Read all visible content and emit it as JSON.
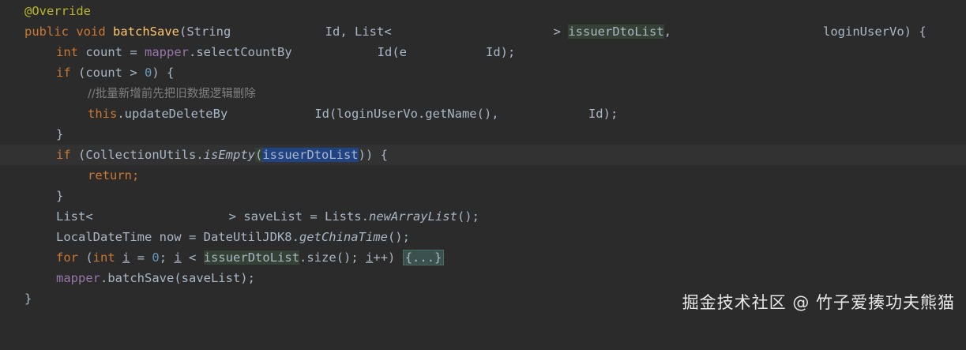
{
  "code": {
    "l1_annotation": "@Override",
    "l2_kw1": "public",
    "l2_kw2": "void",
    "l2_method": "batchSave",
    "l2_p1": "(String ",
    "l2_p2": "Id, List<",
    "l2_p3": "> ",
    "l2_param": "issuerDtoList",
    "l2_p4": ",",
    "l2_p5": "loginUserVo) {",
    "l3_kw": "int",
    "l3_a": " count = ",
    "l3_field": "mapper",
    "l3_b": ".selectCountBy",
    "l3_c": "Id(e",
    "l3_d": "Id);",
    "l4_kw": "if",
    "l4_a": " (count > ",
    "l4_num": "0",
    "l4_b": ") {",
    "l5_comment": "//批量新增前先把旧数据逻辑删除",
    "l6_kw": "this",
    "l6_a": ".updateDeleteBy",
    "l6_b": "Id(loginUserVo.getName(), ",
    "l6_c": "Id);",
    "l7": "}",
    "l8_kw": "if",
    "l8_a": " (CollectionUtils.",
    "l8_static": "isEmpty",
    "l8_b": "(",
    "l8_sel": "issuerDtoList",
    "l8_c": ")) {",
    "l9_kw": "return",
    "l9_semi": ";",
    "l10": "}",
    "l11_a": "List<",
    "l11_b": "> saveList = Lists.",
    "l11_static": "newArrayList",
    "l11_c": "();",
    "l12_a": "LocalDateTime now = DateUtilJDK8.",
    "l12_static": "getChinaTime",
    "l12_b": "();",
    "l13_kw": "for",
    "l13_a": " (",
    "l13_kw2": "int",
    "l13_var": "i",
    "l13_b": " = ",
    "l13_num": "0",
    "l13_c": "; ",
    "l13_var2": "i",
    "l13_d": " < ",
    "l13_param": "issuerDtoList",
    "l13_e": ".size(); ",
    "l13_var3": "i",
    "l13_f": "++) ",
    "l13_fold": "{...}",
    "l14_field": "mapper",
    "l14_a": ".batchSave(saveList);",
    "l15": "}"
  },
  "watermark": "掘金技术社区 @ 竹子爱揍功夫熊猫",
  "icons": {
    "gutter": "lightbulb-icon"
  }
}
